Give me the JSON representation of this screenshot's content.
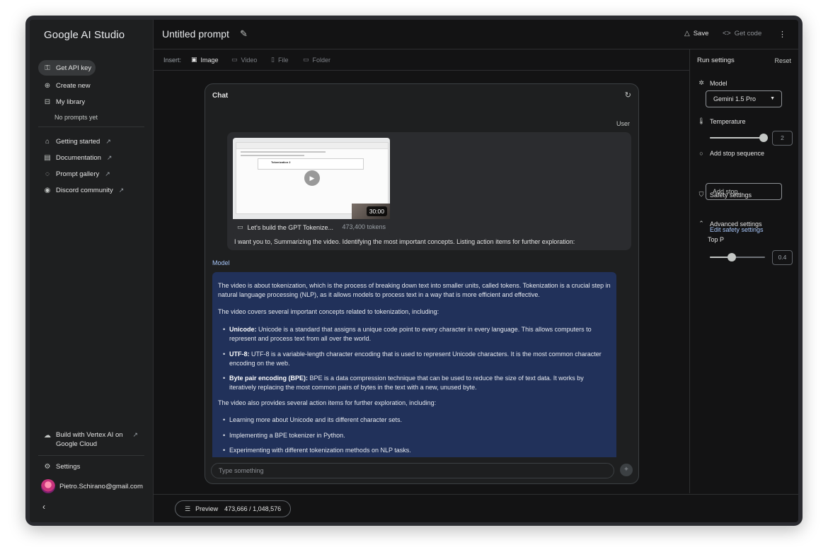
{
  "brand": "Google AI Studio",
  "sidebar": {
    "get_api_key": "Get API key",
    "create_new": "Create new",
    "my_library": "My library",
    "no_prompts": "No prompts yet",
    "links": [
      {
        "label": "Getting started"
      },
      {
        "label": "Documentation"
      },
      {
        "label": "Prompt gallery"
      },
      {
        "label": "Discord community"
      }
    ],
    "vertex_line1": "Build with Vertex AI on",
    "vertex_line2": "Google Cloud",
    "settings": "Settings",
    "user_email": "Pietro.Schirano@gmail.com",
    "collapse": "‹"
  },
  "header": {
    "title": "Untitled prompt",
    "save": "Save",
    "get_code": "Get code"
  },
  "insert": {
    "label": "Insert:",
    "image": "Image",
    "video": "Video",
    "file": "File",
    "folder": "Folder"
  },
  "chat": {
    "title": "Chat",
    "user_role": "User",
    "video_title": "Let's build the GPT Tokenize...",
    "video_tokens": "473,400 tokens",
    "video_duration": "30:00",
    "thumb_heading": "Tokenization 2",
    "prompt": "I want you to, Summarizing the video. Identifying the most important concepts. Listing action items for further exploration:",
    "model_role": "Model",
    "response": {
      "p1": "The video is about tokenization, which is the process of breaking down text into smaller units, called tokens. Tokenization is a crucial step in natural language processing (NLP), as it allows models to process text in a way that is more efficient and effective.",
      "p2": "The video covers several important concepts related to tokenization, including:",
      "b1_title": "Unicode:",
      "b1_text": " Unicode is a standard that assigns a unique code point to every character in every language. This allows computers to represent and process text from all over the world.",
      "b2_title": "UTF-8:",
      "b2_text": " UTF-8 is a variable-length character encoding that is used to represent Unicode characters. It is the most common character encoding on the web.",
      "b3_title": "Byte pair encoding (BPE):",
      "b3_text": " BPE is a data compression technique that can be used to reduce the size of text data. It works by iteratively replacing the most common pairs of bytes in the text with a new, unused byte.",
      "p3": "The video also provides several action items for further exploration, including:",
      "a1": "Learning more about Unicode and its different character sets.",
      "a2": "Implementing a BPE tokenizer in Python.",
      "a3": "Experimenting with different tokenization methods on NLP tasks."
    },
    "input_placeholder": "Type something"
  },
  "footer": {
    "preview": "Preview",
    "token_count": "473,666 / 1,048,576"
  },
  "run_settings": {
    "title": "Run settings",
    "reset": "Reset",
    "model_label": "Model",
    "model_value": "Gemini 1.5 Pro",
    "temperature_label": "Temperature",
    "temperature_value": "2",
    "temperature_fraction": 1.0,
    "stop_label": "Add stop sequence",
    "stop_placeholder": "Add stop...",
    "safety_label": "Safety settings",
    "safety_link": "Edit safety settings",
    "advanced_label": "Advanced settings",
    "top_p_label": "Top P",
    "top_p_value": "0.4",
    "top_p_fraction": 0.4
  },
  "icons": {
    "key": "key-icon",
    "plus": "plus-circle-icon",
    "library": "library-icon",
    "refresh": "refresh-icon",
    "video": "video-icon",
    "send": "send-icon"
  },
  "colors": {
    "accent_link": "#a8c7fa",
    "model_bubble": "#21315a",
    "background": "#131314"
  }
}
